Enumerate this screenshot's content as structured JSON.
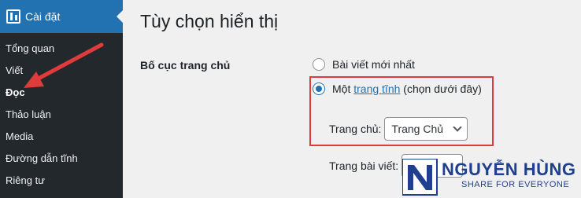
{
  "sidebar": {
    "section_title": "Cài đặt",
    "section_icon": "settings-sliders-icon",
    "items": [
      {
        "label": "Tổng quan"
      },
      {
        "label": "Viết"
      },
      {
        "label": "Đọc",
        "current": true
      },
      {
        "label": "Thảo luận"
      },
      {
        "label": "Media"
      },
      {
        "label": "Đường dẫn tĩnh"
      },
      {
        "label": "Riêng tư"
      }
    ]
  },
  "main": {
    "title": "Tùy chọn hiển thị",
    "homepage_label": "Bố cục trang chủ",
    "option_latest": "Bài viết mới nhất",
    "option_static_prefix": "Một",
    "option_static_link": "trang tĩnh",
    "option_static_suffix": "(chọn dưới đây)",
    "selected_option": "static",
    "homepage_select_label": "Trang chủ:",
    "homepage_select_value": "Trang Chủ",
    "posts_page_label": "Trang bài viết:"
  },
  "watermark": {
    "name": "NGUYỄN HÙNG",
    "tagline": "SHARE FOR EVERYONE"
  },
  "colors": {
    "sidebar_bg": "#23282d",
    "accent": "#2271b1",
    "annotation_red": "#e03b3b",
    "watermark_blue": "#1f3f8f"
  }
}
